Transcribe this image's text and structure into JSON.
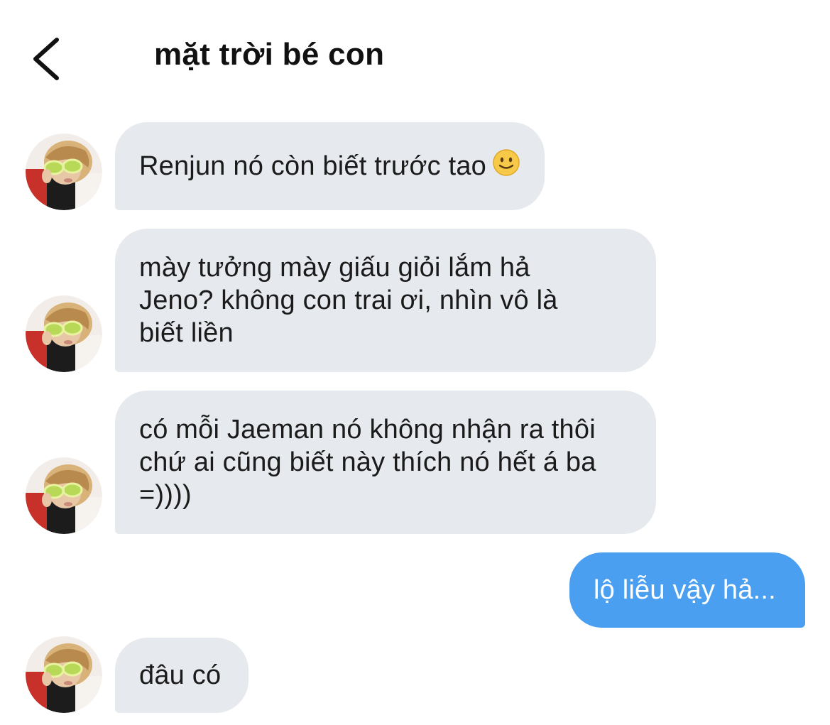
{
  "header": {
    "title": "mặt trời bé con",
    "back_icon": "chevron-left-icon"
  },
  "messages": [
    {
      "direction": "incoming",
      "text": "Renjun nó còn biết trước tao",
      "emoji": "slightly-smiling-face"
    },
    {
      "direction": "incoming",
      "text": "mày tưởng mày giấu giỏi lắm hả\nJeno? không con trai ơi, nhìn vô là\nbiết liền"
    },
    {
      "direction": "incoming",
      "text": "có mỗi Jaeman nó không nhận ra thôi\nchứ ai cũng biết này thích nó hết á ba\n=))))"
    },
    {
      "direction": "outgoing",
      "text": "lộ liễu vậy hả..."
    },
    {
      "direction": "incoming",
      "text": "đâu có"
    }
  ],
  "colors": {
    "incoming_bubble": "#e6e9ee",
    "outgoing_bubble": "#4b9ff1",
    "outgoing_text": "#ffffff",
    "text": "#1b1b1b"
  }
}
